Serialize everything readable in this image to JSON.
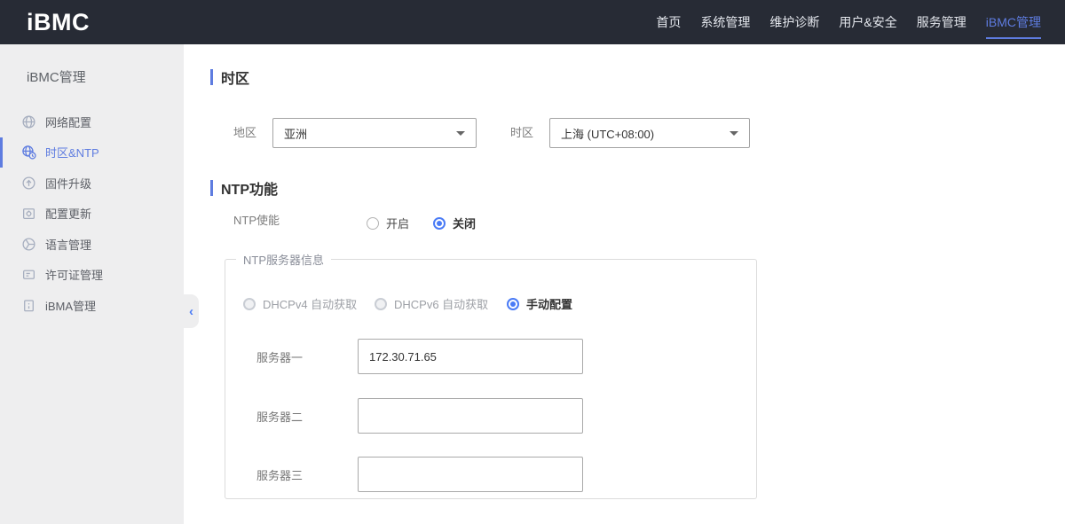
{
  "header": {
    "logo": "iBMC",
    "nav": [
      {
        "label": "首页",
        "active": false
      },
      {
        "label": "系统管理",
        "active": false
      },
      {
        "label": "维护诊断",
        "active": false
      },
      {
        "label": "用户&安全",
        "active": false
      },
      {
        "label": "服务管理",
        "active": false
      },
      {
        "label": "iBMC管理",
        "active": true
      }
    ]
  },
  "sidebar": {
    "title": "iBMC管理",
    "items": [
      {
        "label": "网络配置",
        "icon": "globe-icon",
        "active": false
      },
      {
        "label": "时区&NTP",
        "icon": "timezone-clock-icon",
        "active": true
      },
      {
        "label": "固件升级",
        "icon": "firmware-upload-icon",
        "active": false
      },
      {
        "label": "配置更新",
        "icon": "config-update-icon",
        "active": false
      },
      {
        "label": "语言管理",
        "icon": "language-icon",
        "active": false
      },
      {
        "label": "许可证管理",
        "icon": "license-icon",
        "active": false
      },
      {
        "label": "iBMA管理",
        "icon": "package-icon",
        "active": false
      }
    ],
    "collapse_icon": "‹"
  },
  "main": {
    "timezone_section": {
      "title": "时区",
      "region_label": "地区",
      "region_value": "亚洲",
      "timezone_label": "时区",
      "timezone_value": "上海 (UTC+08:00)"
    },
    "ntp_section": {
      "title": "NTP功能",
      "enable_label": "NTP使能",
      "enable_options": [
        {
          "label": "开启",
          "selected": false
        },
        {
          "label": "关闭",
          "selected": true
        }
      ],
      "server_group": {
        "legend": "NTP服务器信息",
        "mode_options": [
          {
            "label": "DHCPv4 自动获取",
            "selected": false,
            "disabled": true
          },
          {
            "label": "DHCPv6 自动获取",
            "selected": false,
            "disabled": true
          },
          {
            "label": "手动配置",
            "selected": true,
            "disabled": false
          }
        ],
        "servers": [
          {
            "label": "服务器一",
            "value": "172.30.71.65"
          },
          {
            "label": "服务器二",
            "value": ""
          },
          {
            "label": "服务器三",
            "value": ""
          }
        ]
      }
    }
  },
  "colors": {
    "header_bg": "#272b35",
    "sidebar_bg": "#eeeeef",
    "accent_blue": "#5e7ce0",
    "radio_blue": "#4a7bf6",
    "text_dark": "#333333",
    "text_gray": "#7d7d7d"
  }
}
